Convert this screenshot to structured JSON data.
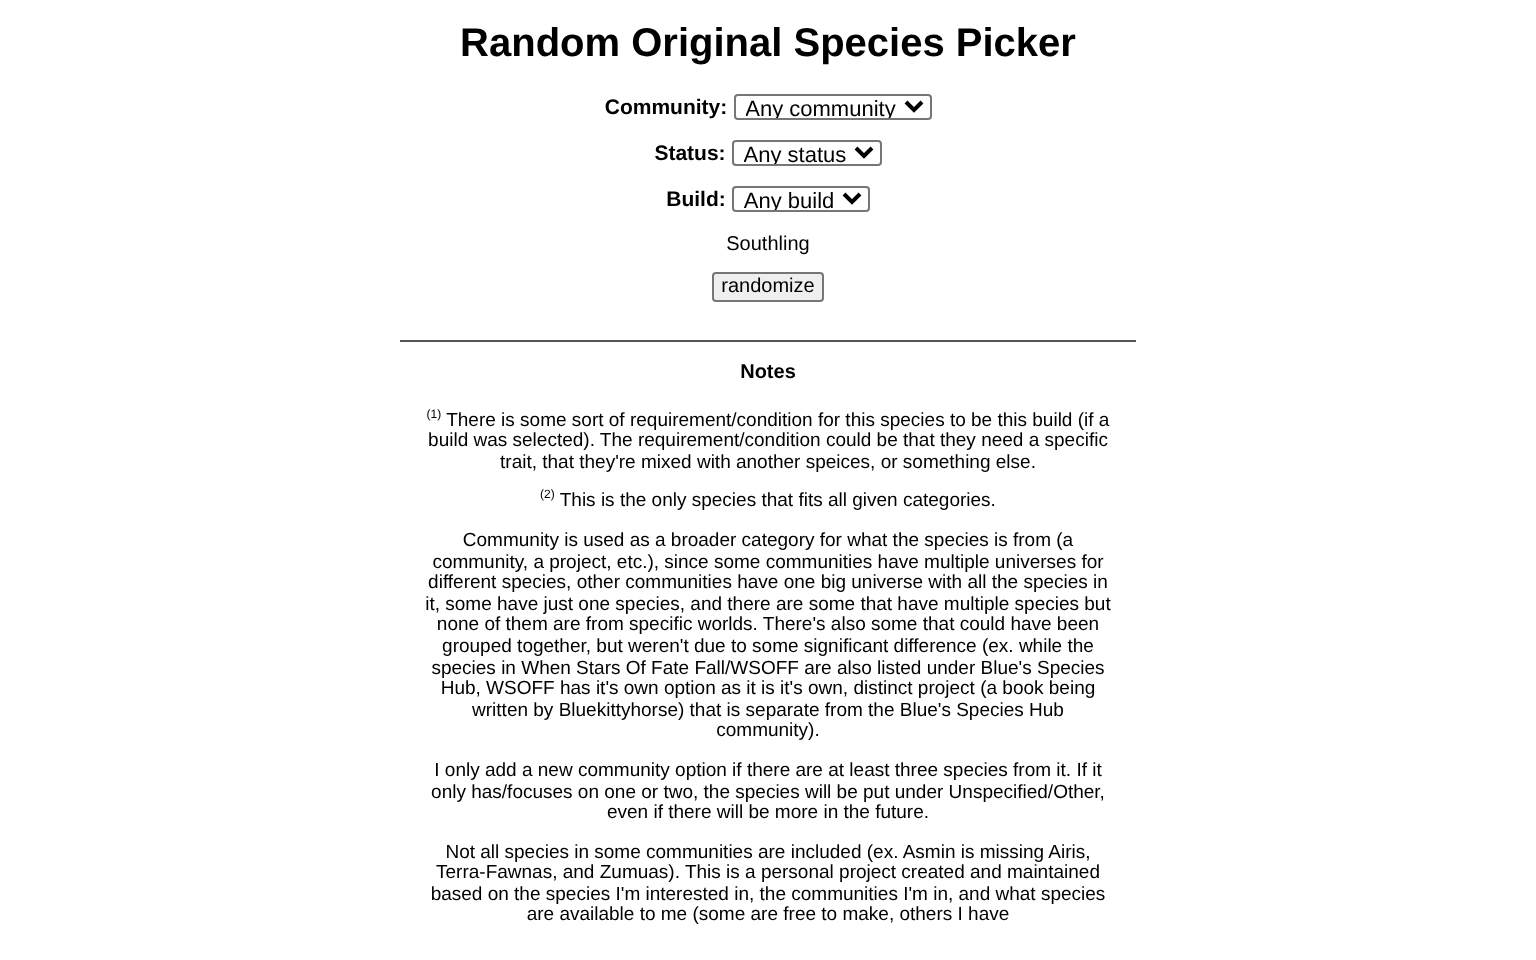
{
  "title": "Random Original Species Picker",
  "filters": [
    {
      "label": "Community:",
      "value": "Any community"
    },
    {
      "label": "Status:",
      "value": "Any status"
    },
    {
      "label": "Build:",
      "value": "Any build"
    }
  ],
  "result": "Southling",
  "button": "randomize",
  "notes": {
    "heading": "Notes",
    "paragraphs": [
      "$^{(1)}$ There is some sort of requirement/condition for this species to be this build (if a build was selected). The requirement/condition could be that they need a specific trait, that they're mixed with another speices, or something else.",
      "$^{(2)}$ This is the only species that fits all given categories.",
      "Community is used as a broader category for what the species is from (a community, a project, etc.), since some communities have multiple universes for different species, other communities have one big universe with all the species in it, some have just one species, and there are some that have multiple species but none of them are from specific worlds. There's also some that could have been grouped together, but weren't due to some significant difference (ex. while the species in When Stars Of Fate Fall/WSOFF are also listed under Blue's Species Hub, WSOFF has it's own option as it is it's own, distinct project (a book being written by Bluekittyhorse) that is separate from the Blue's Species Hub community).",
      "I only add a new community option if there are at least three species from it. If it only has/focuses on one or two, the species will be put under Unspecified/Other, even if there will be more in the future.",
      "Not all species in some communities are included (ex. Asmin is missing Airis, Terra-Fawnas, and Zumuas). This is a personal project created and maintained based on the species I'm interested in, the communities I'm in, and what species are available to me (some are free to make, others I have"
    ]
  }
}
